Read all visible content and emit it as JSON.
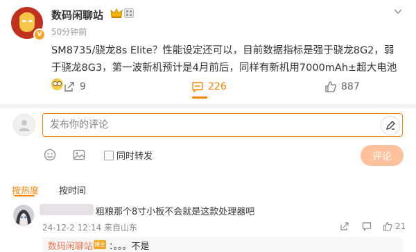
{
  "post": {
    "author": "数码闲聊站",
    "time_ago": "50分钟前",
    "text": "SM8735/骁龙8s Elite？性能设定还可以，目前数据指标是强于骁龙8G2，弱于骁龙8G3，第一波新机预计是4月前后，同样有新机用7000mAh±超大电池",
    "emoji": "glasses-face-emoji"
  },
  "actions": {
    "repost_count": "9",
    "comment_count": "226",
    "like_count": "887"
  },
  "composer": {
    "placeholder": "发布你的评论",
    "also_repost_label": "同时转发",
    "submit_label": "评论"
  },
  "sort_tabs": {
    "hot": "按热度",
    "time": "按时间",
    "active": "hot"
  },
  "comments": [
    {
      "text": "粗粮那个8寸小板不会就是这款处理器吧",
      "meta": "24-12-2 12:14 来自山东",
      "like_count": "21",
      "reply": {
        "author": "数码闲聊站",
        "badge": "博主",
        "text": "：。。。不是"
      }
    }
  ],
  "colors": {
    "accent": "#ff8200",
    "submit_disabled": "#ffc09a",
    "reply_name": "#eb7350"
  }
}
